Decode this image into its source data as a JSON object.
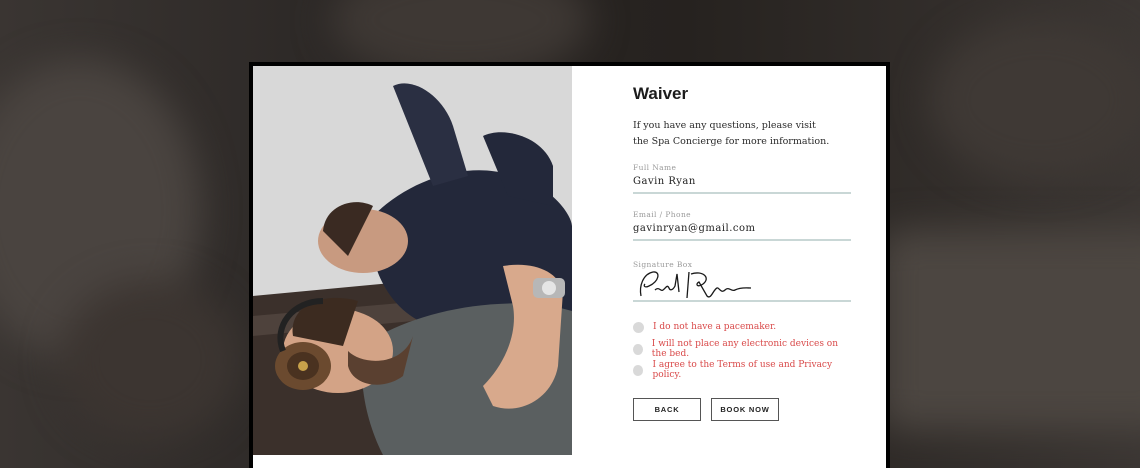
{
  "waiver": {
    "title": "Waiver",
    "intro": "If you have any questions, please visit the Spa Concierge for more information.",
    "full_name_label": "Full Name",
    "full_name_value": "Gavin Ryan",
    "email_label": "Email / Phone",
    "email_value": "gavinryan@gmail.com",
    "signature_label": "Signature Box",
    "checkboxes": [
      {
        "label": "I do not have a pacemaker.",
        "checked": false
      },
      {
        "label": "I will not place any electronic devices on the bed.",
        "checked": false
      },
      {
        "label": "I agree to the Terms of use and Privacy policy.",
        "checked": false
      }
    ],
    "back_label": "BACK",
    "book_label": "BOOK NOW"
  },
  "colors": {
    "accent_red": "#d94a4a",
    "field_line": "#c9d7d6",
    "backdrop": "#2a2624"
  },
  "icons": {
    "photo": "spa-clients-photo",
    "signature": "signature-drawing",
    "checkbox": "radio-circle"
  }
}
